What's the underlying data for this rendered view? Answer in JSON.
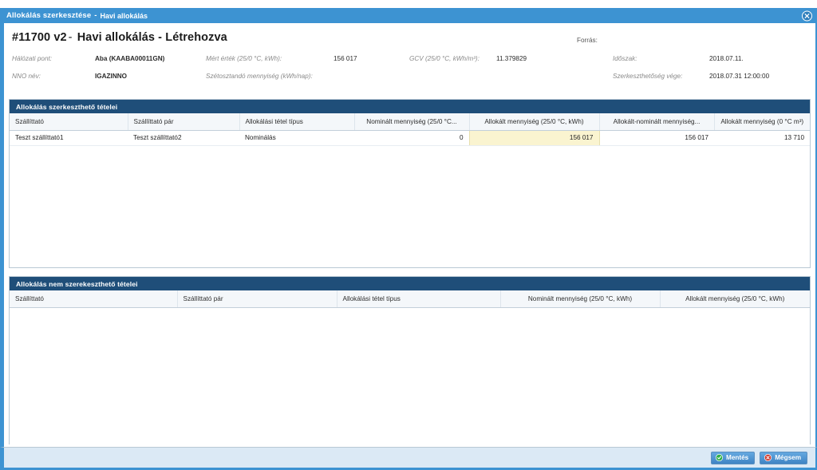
{
  "window": {
    "title": "Allokálás szerkesztése",
    "separator": "-",
    "subtitle": "Havi allokálás",
    "close_icon": "close-circle-icon",
    "titlebar_color": "#3d93d2"
  },
  "header": {
    "doc_id": "#11700 v2",
    "dash": "-",
    "doc_title": "Havi allokálás - Létrehozva",
    "fields": {
      "halozati_pont_label": "Hálózati pont:",
      "halozati_pont_value": "Aba (KAABA00011GN)",
      "nno_nev_label": "NNO név:",
      "nno_nev_value": "IGAZINNO",
      "mert_ertek_label": "Mért érték (25/0 °C, kWh):",
      "mert_ertek_value": "156 017",
      "szetosztando_label": "Szétosztandó mennyiség (kWh/nap):",
      "szetosztando_value": "",
      "gcv_label": "GCV (25/0 °C, kWh/m³):",
      "gcv_value": "11.379829",
      "forras_label": "Forrás:",
      "forras_value": "",
      "idoszak_label": "Időszak:",
      "idoszak_value": "2018.07.11.",
      "szerkeszthetoseg_label": "Szerkeszthetőség vége:",
      "szerkeszthetoseg_value": "2018.07.31 12:00:00"
    }
  },
  "editable_section": {
    "title": "Allokálás szerkeszthető tételei",
    "columns": [
      "Szállíttató",
      "Szállíttató pár",
      "Allokálási tétel típus",
      "Nominált mennyiség (25/0 °C...",
      "Allokált mennyiség (25/0 °C, kWh)",
      "Allokált-nominált mennyiség...",
      "Allokált mennyiség (0 °C m³)"
    ],
    "rows": [
      {
        "szallittato": "Teszt szállíttató1",
        "szallittato_par": "Teszt szállíttató2",
        "tetel_tipus": "Nominálás",
        "nominalt": "0",
        "allokalt": "156 017",
        "allokalt_nominalt": "156 017",
        "allokalt_m3": "13 710"
      }
    ],
    "highlight_color": "#faf4d0"
  },
  "readonly_section": {
    "title": "Allokálás nem szerekeszthető tételei",
    "columns": [
      "Szállíttató",
      "Szállíttató pár",
      "Allokálási tétel típus",
      "Nominált mennyiség (25/0 °C, kWh)",
      "Allokált mennyiség (25/0 °C, kWh)"
    ],
    "rows": []
  },
  "footer": {
    "save_label": "Mentés",
    "save_icon": "check-circle-icon",
    "cancel_label": "Mégsem",
    "cancel_icon": "cancel-circle-icon",
    "save_icon_color": "#2fae4a",
    "cancel_icon_color": "#d03a2e"
  }
}
